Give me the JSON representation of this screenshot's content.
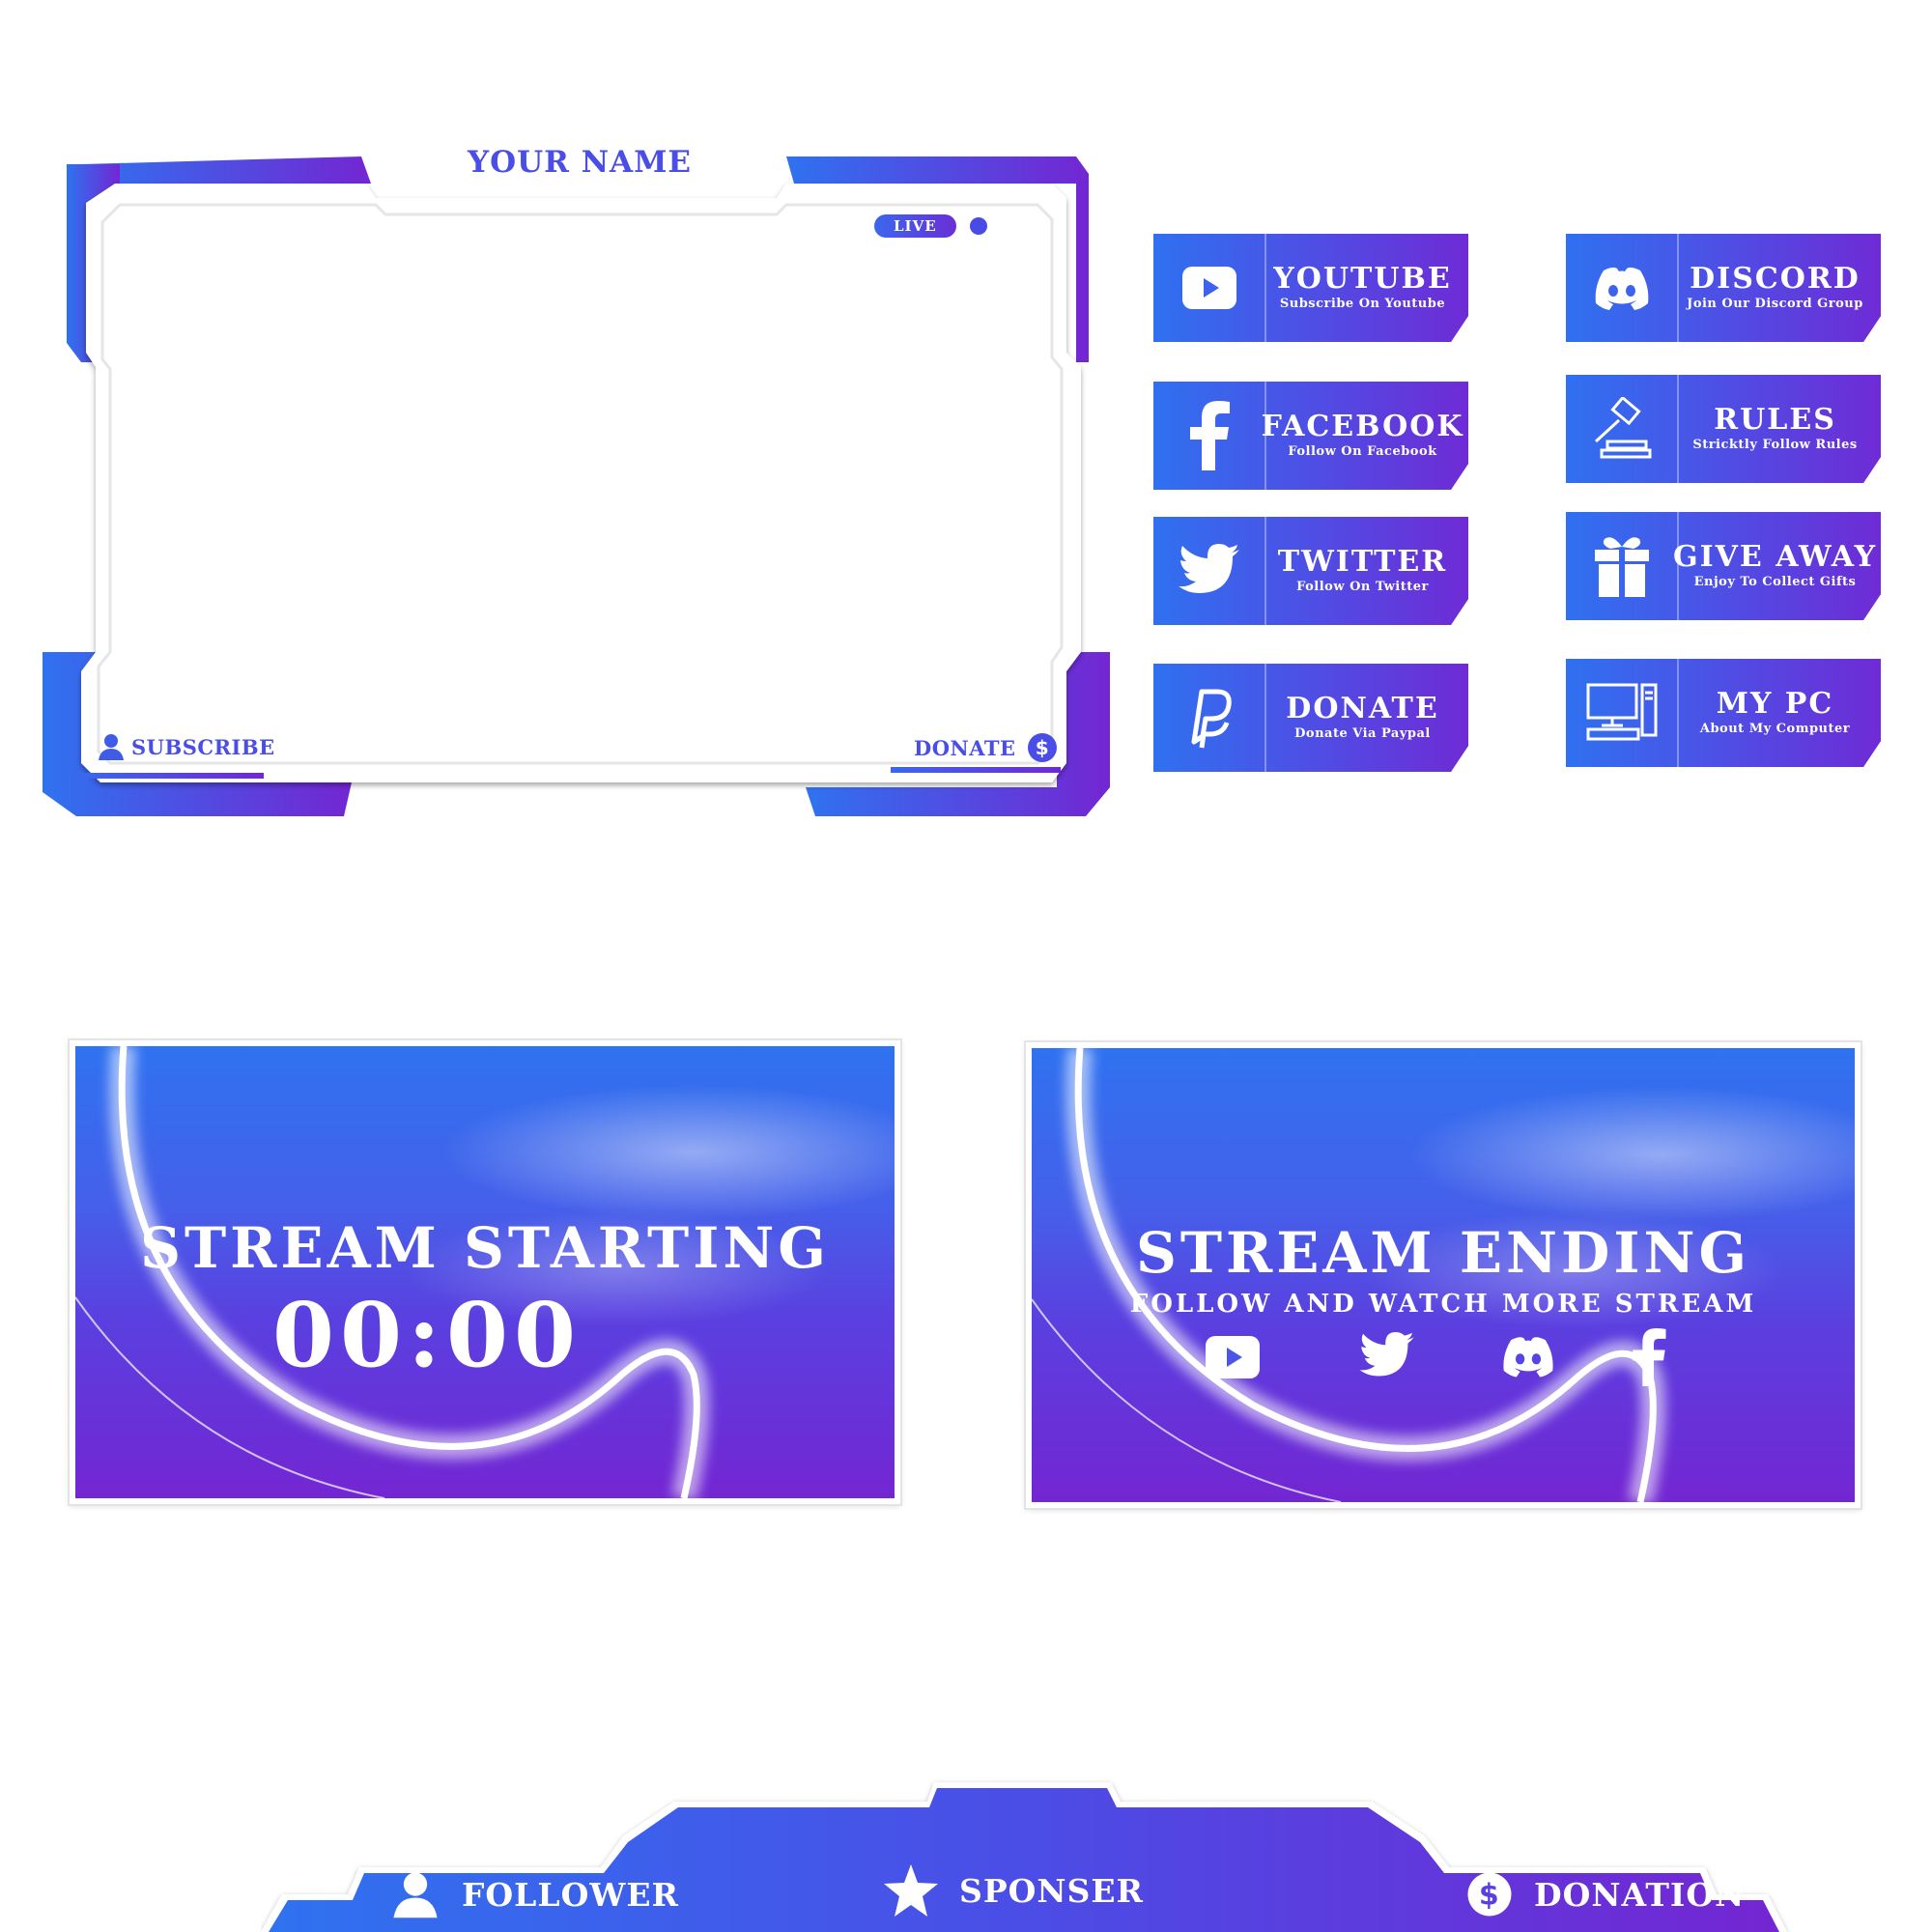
{
  "webcam_frame": {
    "title": "YOUR NAME",
    "live_label": "LIVE",
    "subscribe_label": "SUBSCRIBE",
    "donate_label": "DONATE"
  },
  "panels": [
    {
      "title": "YOUTUBE",
      "subtitle": "Subscribe On Youtube",
      "icon": "youtube-icon"
    },
    {
      "title": "DISCORD",
      "subtitle": "Join Our Discord Group",
      "icon": "discord-icon"
    },
    {
      "title": "FACEBOOK",
      "subtitle": "Follow On Facebook",
      "icon": "facebook-icon"
    },
    {
      "title": "RULES",
      "subtitle": "Stricktly Follow Rules",
      "icon": "gavel-icon"
    },
    {
      "title": "TWITTER",
      "subtitle": "Follow On Twitter",
      "icon": "twitter-icon"
    },
    {
      "title": "GIVE AWAY",
      "subtitle": "Enjoy To Collect Gifts",
      "icon": "gift-icon"
    },
    {
      "title": "DONATE",
      "subtitle": "Donate Via Paypal",
      "icon": "paypal-icon"
    },
    {
      "title": "MY PC",
      "subtitle": "About My Computer",
      "icon": "computer-icon"
    }
  ],
  "starting_scene": {
    "title": "STREAM STARTING",
    "timer": "00:00"
  },
  "ending_scene": {
    "title": "STREAM ENDING",
    "subtitle": "FOLLOW AND WATCH MORE STREAM",
    "icons": [
      "youtube-icon",
      "twitter-icon",
      "discord-icon",
      "facebook-icon"
    ]
  },
  "bottom_bar": {
    "follower_label": "FOLLOWER",
    "sponser_label": "SPONSER",
    "donation_label": "DONATION"
  },
  "colors": {
    "gradient_start": "#2f72f0",
    "gradient_end": "#7326d2",
    "accent_text": "#4a4de6"
  }
}
